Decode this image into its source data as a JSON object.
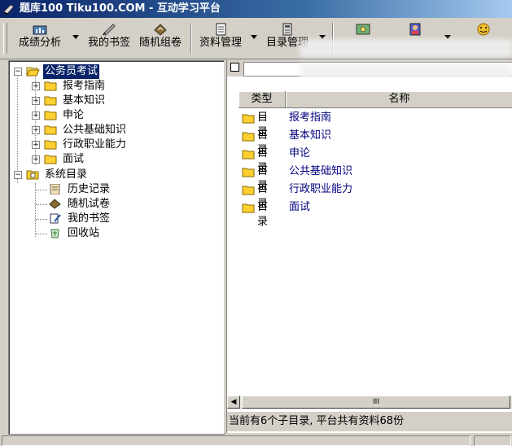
{
  "window": {
    "title": "题库100  Tiku100.COM  - 互动学习平台",
    "colors": {
      "titlebar": "#0a246a",
      "chrome": "#d4d0c8",
      "selection": "#0a246a",
      "link": "#00007f",
      "folder": "#ffd700"
    }
  },
  "toolbar": {
    "buttons": [
      {
        "label": "成绩分析",
        "icon": "bar-chart-icon",
        "has_dropdown": true
      },
      {
        "label": "我的书签",
        "icon": "bookmark-pen-icon",
        "has_dropdown": false
      },
      {
        "label": "随机组卷",
        "icon": "random-paper-icon",
        "has_dropdown": false
      },
      {
        "label": "资料管理",
        "icon": "document-icon",
        "has_dropdown": true
      },
      {
        "label": "目录管理",
        "icon": "catalog-icon",
        "has_dropdown": true
      }
    ],
    "extra_icons": [
      "image-icon",
      "contact-icon",
      "smiley-icon"
    ]
  },
  "tree": {
    "root": {
      "label": "公务员考试",
      "expanded": true,
      "selected": true
    },
    "children": [
      {
        "label": "报考指南"
      },
      {
        "label": "基本知识"
      },
      {
        "label": "申论"
      },
      {
        "label": "公共基础知识"
      },
      {
        "label": "行政职业能力"
      },
      {
        "label": "面试"
      }
    ],
    "system": {
      "label": "系统目录",
      "children": [
        {
          "label": "历史记录",
          "icon": "history-icon"
        },
        {
          "label": "随机试卷",
          "icon": "random-paper-icon"
        },
        {
          "label": "我的书签",
          "icon": "bookmark-icon"
        },
        {
          "label": "回收站",
          "icon": "recycle-bin-icon"
        }
      ]
    }
  },
  "list": {
    "columns": [
      "类型",
      "名称"
    ],
    "rows": [
      {
        "type": "目录",
        "name": "报考指南"
      },
      {
        "type": "目录",
        "name": "基本知识"
      },
      {
        "type": "目录",
        "name": "申论"
      },
      {
        "type": "目录",
        "name": "公共基础知识"
      },
      {
        "type": "目录",
        "name": "行政职业能力"
      },
      {
        "type": "目录",
        "name": "面试"
      }
    ],
    "scroll_thumb_label": "III"
  },
  "status": {
    "info": "当前有6个子目录, 平台共有资料68份"
  }
}
